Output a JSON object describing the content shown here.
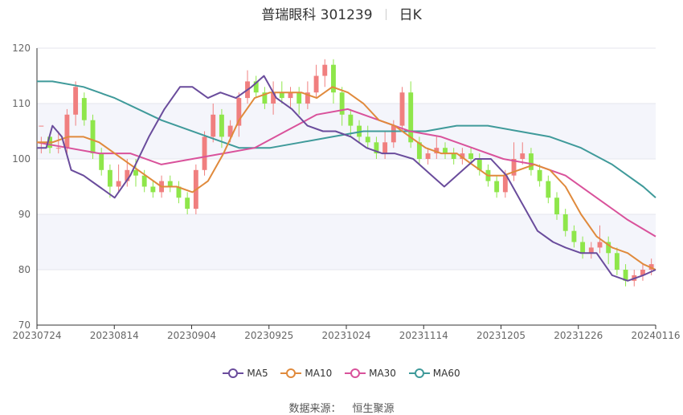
{
  "chart_data": {
    "type": "candlestick",
    "title": "普瑞眼科 301239",
    "period": "日K",
    "ylim": [
      70,
      120
    ],
    "yticks": [
      70,
      80,
      90,
      100,
      110,
      120
    ],
    "xtick_labels": [
      "20230724",
      "20230814",
      "20230904",
      "20230925",
      "20231024",
      "20231114",
      "20231205",
      "20231226",
      "20240116"
    ],
    "grid": true,
    "legend_position": "bottom",
    "series": [
      {
        "name": "MA5",
        "color": "#6a4c9c"
      },
      {
        "name": "MA10",
        "color": "#e08a3c"
      },
      {
        "name": "MA30",
        "color": "#d9529b"
      },
      {
        "name": "MA60",
        "color": "#3f9a9a"
      }
    ],
    "colors": {
      "up": "#f07f7f",
      "down": "#8ee64a"
    },
    "ohlc": [
      [
        106,
        106,
        104,
        101
      ],
      [
        104,
        102,
        103,
        101
      ],
      [
        102,
        102,
        105,
        101
      ],
      [
        102,
        108,
        109,
        101
      ],
      [
        108,
        113,
        114,
        106
      ],
      [
        111,
        107,
        112,
        106
      ],
      [
        107,
        101,
        108,
        100
      ],
      [
        101,
        98,
        102,
        97
      ],
      [
        98,
        95,
        99,
        93
      ],
      [
        95,
        96,
        99,
        94
      ],
      [
        96,
        98,
        100,
        95
      ],
      [
        98,
        97,
        100,
        95
      ],
      [
        97,
        95,
        98,
        94
      ],
      [
        95,
        94,
        96,
        93
      ],
      [
        94,
        96,
        97,
        93
      ],
      [
        96,
        95,
        97,
        94
      ],
      [
        95,
        93,
        96,
        92
      ],
      [
        93,
        91,
        94,
        90
      ],
      [
        91,
        98,
        99,
        90
      ],
      [
        98,
        104,
        105,
        97
      ],
      [
        104,
        108,
        110,
        103
      ],
      [
        108,
        104,
        109,
        102
      ],
      [
        104,
        106,
        107,
        103
      ],
      [
        106,
        111,
        112,
        104
      ],
      [
        111,
        114,
        116,
        110
      ],
      [
        114,
        112,
        115,
        111
      ],
      [
        112,
        110,
        113,
        109
      ],
      [
        110,
        112,
        114,
        108
      ],
      [
        112,
        111,
        114,
        110
      ],
      [
        111,
        112,
        113,
        109
      ],
      [
        112,
        110,
        113,
        108
      ],
      [
        110,
        112,
        114,
        109
      ],
      [
        112,
        115,
        117,
        111
      ],
      [
        115,
        117,
        118,
        113
      ],
      [
        117,
        112,
        118,
        110
      ],
      [
        112,
        108,
        113,
        106
      ],
      [
        108,
        106,
        109,
        104
      ],
      [
        106,
        104,
        107,
        103
      ],
      [
        104,
        103,
        106,
        102
      ],
      [
        103,
        101,
        104,
        100
      ],
      [
        101,
        103,
        105,
        100
      ],
      [
        103,
        106,
        107,
        102
      ],
      [
        106,
        112,
        113,
        105
      ],
      [
        112,
        103,
        114,
        102
      ],
      [
        103,
        100,
        104,
        99
      ],
      [
        100,
        101,
        102,
        99
      ],
      [
        101,
        102,
        104,
        100
      ],
      [
        102,
        101,
        103,
        100
      ],
      [
        101,
        100,
        102,
        99
      ],
      [
        100,
        101,
        102,
        99
      ],
      [
        101,
        100,
        102,
        99
      ],
      [
        100,
        98,
        101,
        97
      ],
      [
        98,
        96,
        99,
        95
      ],
      [
        96,
        94,
        97,
        93
      ],
      [
        94,
        97,
        98,
        93
      ],
      [
        97,
        100,
        103,
        96
      ],
      [
        100,
        101,
        103,
        99
      ],
      [
        101,
        98,
        102,
        97
      ],
      [
        98,
        96,
        99,
        95
      ],
      [
        96,
        93,
        97,
        92
      ],
      [
        93,
        90,
        94,
        89
      ],
      [
        90,
        87,
        91,
        86
      ],
      [
        87,
        85,
        88,
        84
      ],
      [
        85,
        83,
        86,
        82
      ],
      [
        83,
        84,
        85,
        82
      ],
      [
        84,
        85,
        88,
        83
      ],
      [
        85,
        83,
        86,
        81
      ],
      [
        83,
        80,
        84,
        79
      ],
      [
        80,
        78,
        81,
        77
      ],
      [
        78,
        79,
        80,
        77
      ],
      [
        79,
        80,
        81,
        78
      ],
      [
        80,
        81,
        82,
        79
      ]
    ],
    "ma_lines": {
      "MA5": [
        [
          0,
          102
        ],
        [
          3,
          102
        ],
        [
          5,
          106
        ],
        [
          8,
          104
        ],
        [
          11,
          98
        ],
        [
          15,
          97
        ],
        [
          20,
          95
        ],
        [
          25,
          93
        ],
        [
          30,
          97
        ],
        [
          36,
          104
        ],
        [
          41,
          109
        ],
        [
          46,
          113
        ],
        [
          50,
          113
        ],
        [
          55,
          111
        ],
        [
          59,
          112
        ],
        [
          64,
          111
        ],
        [
          69,
          113
        ],
        [
          73,
          115
        ],
        [
          77,
          111
        ],
        [
          82,
          109
        ],
        [
          87,
          106
        ],
        [
          92,
          105
        ],
        [
          96,
          105
        ],
        [
          101,
          104
        ],
        [
          106,
          102
        ],
        [
          111,
          101
        ],
        [
          115,
          101
        ],
        [
          121,
          100
        ],
        [
          127,
          97
        ],
        [
          131,
          95
        ],
        [
          137,
          98
        ],
        [
          141,
          100
        ],
        [
          146,
          100
        ],
        [
          151,
          97
        ],
        [
          156,
          92
        ],
        [
          161,
          87
        ],
        [
          166,
          85
        ],
        [
          170,
          84
        ],
        [
          175,
          83
        ],
        [
          180,
          83
        ],
        [
          185,
          79
        ],
        [
          190,
          78
        ],
        [
          195,
          79
        ],
        [
          199,
          80
        ]
      ],
      "MA10": [
        [
          0,
          103
        ],
        [
          5,
          103
        ],
        [
          10,
          104
        ],
        [
          15,
          104
        ],
        [
          20,
          103
        ],
        [
          25,
          101
        ],
        [
          30,
          99
        ],
        [
          35,
          97
        ],
        [
          40,
          95
        ],
        [
          45,
          95
        ],
        [
          50,
          94
        ],
        [
          55,
          96
        ],
        [
          60,
          101
        ],
        [
          65,
          107
        ],
        [
          70,
          111
        ],
        [
          75,
          112
        ],
        [
          80,
          112
        ],
        [
          85,
          112
        ],
        [
          90,
          111
        ],
        [
          95,
          113
        ],
        [
          100,
          112
        ],
        [
          105,
          110
        ],
        [
          110,
          107
        ],
        [
          115,
          106
        ],
        [
          120,
          104
        ],
        [
          125,
          102
        ],
        [
          130,
          101
        ],
        [
          135,
          101
        ],
        [
          140,
          99
        ],
        [
          145,
          97
        ],
        [
          150,
          97
        ],
        [
          155,
          98
        ],
        [
          160,
          99
        ],
        [
          165,
          98
        ],
        [
          170,
          95
        ],
        [
          175,
          90
        ],
        [
          180,
          86
        ],
        [
          185,
          84
        ],
        [
          190,
          83
        ],
        [
          195,
          81
        ],
        [
          199,
          80
        ]
      ],
      "MA30": [
        [
          0,
          103
        ],
        [
          10,
          102
        ],
        [
          20,
          101
        ],
        [
          30,
          101
        ],
        [
          40,
          99
        ],
        [
          50,
          100
        ],
        [
          60,
          101
        ],
        [
          70,
          102
        ],
        [
          80,
          105
        ],
        [
          90,
          108
        ],
        [
          100,
          109
        ],
        [
          110,
          107
        ],
        [
          120,
          105
        ],
        [
          130,
          104
        ],
        [
          140,
          102
        ],
        [
          150,
          100
        ],
        [
          160,
          99
        ],
        [
          170,
          97
        ],
        [
          180,
          93
        ],
        [
          190,
          89
        ],
        [
          199,
          86
        ]
      ],
      "MA60": [
        [
          0,
          114
        ],
        [
          5,
          114
        ],
        [
          15,
          113
        ],
        [
          25,
          111
        ],
        [
          40,
          107
        ],
        [
          55,
          104
        ],
        [
          65,
          102
        ],
        [
          75,
          102
        ],
        [
          85,
          103
        ],
        [
          95,
          104
        ],
        [
          105,
          105
        ],
        [
          115,
          105
        ],
        [
          125,
          105
        ],
        [
          135,
          106
        ],
        [
          145,
          106
        ],
        [
          155,
          105
        ],
        [
          165,
          104
        ],
        [
          175,
          102
        ],
        [
          185,
          99
        ],
        [
          195,
          95
        ],
        [
          199,
          93
        ]
      ]
    }
  },
  "legend": [
    {
      "label": "MA5",
      "color": "#6a4c9c"
    },
    {
      "label": "MA10",
      "color": "#e08a3c"
    },
    {
      "label": "MA30",
      "color": "#d9529b"
    },
    {
      "label": "MA60",
      "color": "#3f9a9a"
    }
  ],
  "header": {
    "title": "普瑞眼科 301239",
    "period": "日K"
  },
  "footer": {
    "source_label": "数据来源：",
    "source_value": "恒生聚源"
  }
}
